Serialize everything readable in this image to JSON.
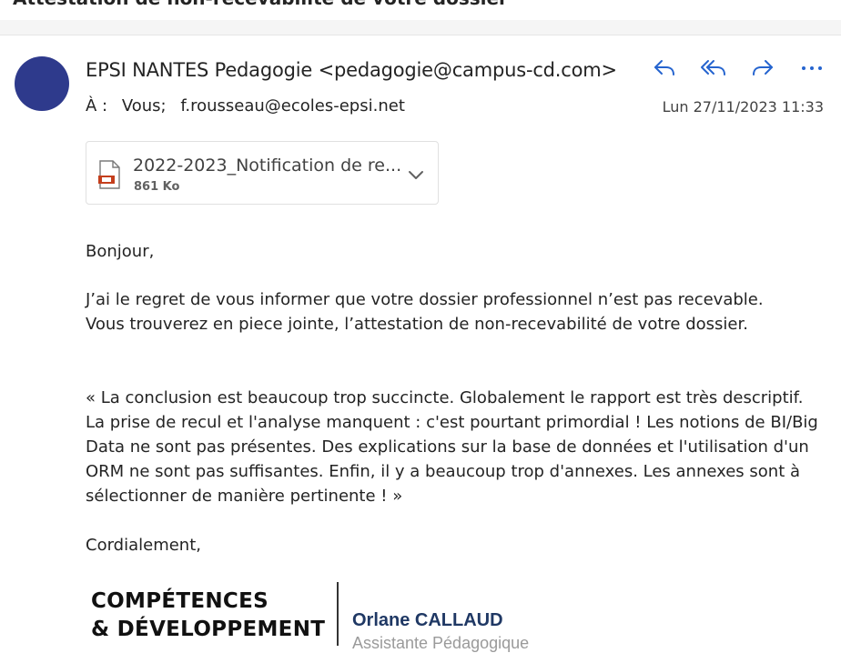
{
  "subject": "Attestation de non-recevabilité de votre dossier",
  "sender": {
    "display": "EPSI NANTES Pedagogie <pedagogie@campus-cd.com>"
  },
  "recipients": {
    "label": "À :",
    "list": [
      "Vous;",
      "f.rousseau@ecoles-epsi.net"
    ]
  },
  "date": "Lun 27/11/2023 11:33",
  "actions": {
    "reply_icon": "reply-icon",
    "reply_all_icon": "reply-all-icon",
    "forward_icon": "forward-icon",
    "more_icon": "more-icon"
  },
  "attachment": {
    "name": "2022-2023_Notification de re...",
    "size": "861 Ko",
    "icon": "pdf-file-icon"
  },
  "body": {
    "greeting": "Bonjour,",
    "para1_line1": "J’ai le regret de vous informer que votre dossier professionnel n’est pas recevable.",
    "para1_line2": "Vous trouverez en piece jointe, l’attestation de non-recevabilité de votre dossier.",
    "quote": "« La conclusion est beaucoup trop succincte. Globalement le rapport est très descriptif. La prise de recul et l'analyse manquent : c'est pourtant primordial ! Les notions de BI/Big Data ne sont pas présentes. Des explications sur la base de données et l'utilisation d'un ORM ne sont pas suffisantes. Enfin, il y a beaucoup trop d'annexes. Les annexes sont à sélectionner de manière pertinente ! »",
    "closing": "Cordialement,"
  },
  "signature": {
    "logo_line1": "COMPÉTENCES",
    "logo_line2": "& DÉVELOPPEMENT",
    "name": "Orlane CALLAUD",
    "role": "Assistante Pédagogique"
  },
  "colors": {
    "avatar": "#2e3a8c",
    "accent": "#2564cf",
    "signature_name": "#1f3864"
  }
}
